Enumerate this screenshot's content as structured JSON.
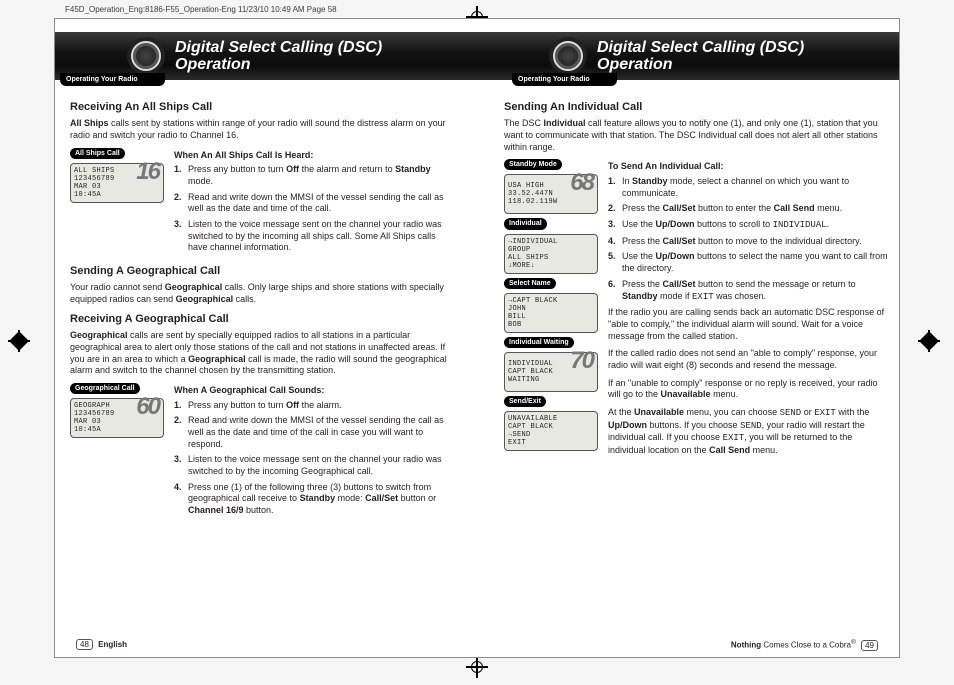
{
  "header_line": "F45D_Operation_Eng:8186-F55_Operation-Eng  11/23/10  10:49 AM  Page 58",
  "banner": {
    "left_title_1": "Digital Select Calling (DSC)",
    "left_title_2": "Operation",
    "right_title_1": "Digital Select Calling (DSC)",
    "right_title_2": "Operation",
    "left_sub": "Operating Your Radio",
    "right_sub": "Operating Your Radio"
  },
  "left": {
    "sec1_h": "Receiving An All Ships Call",
    "sec1_p": "All Ships calls sent by stations within range of your radio will sound the distress alarm on your radio and switch your radio to Channel 16.",
    "sec1_tag": "All Ships Call",
    "sec1_lcd_l1": "ALL SHIPS",
    "sec1_lcd_l2": "123456789",
    "sec1_lcd_l3": "MAR 03",
    "sec1_lcd_l4": "10:45A",
    "sec1_lcd_big": "16",
    "sec1_h3": "When An All Ships Call Is Heard:",
    "sec1_s1a": "Press any button to turn ",
    "sec1_s1b": "Off",
    "sec1_s1c": " the alarm and return to ",
    "sec1_s1d": "Standby",
    "sec1_s1e": " mode.",
    "sec1_s2": "Read and write down the MMSI of the vessel sending the call as well as the date and time of the call.",
    "sec1_s3": "Listen to the voice message sent on the channel your radio was switched to by the incoming all ships call. Some All Ships calls have channel information.",
    "sec2_h": "Sending A Geographical Call",
    "sec2_p1": "Your radio cannot send ",
    "sec2_p2": "Geographical",
    "sec2_p3": " calls. Only large ships and shore stations with specially equipped radios can send ",
    "sec2_p4": "Geographical",
    "sec2_p5": " calls.",
    "sec3_h": "Receiving A Geographical Call",
    "sec3_p1": "Geographical",
    "sec3_p2": " calls are sent by specially equipped radios to all stations in a particular geographical area to alert only those stations of the call and not stations in unaffected areas. If you are in an area to which a ",
    "sec3_p3": "Geographical",
    "sec3_p4": " call is made, the radio will sound the geographical alarm and switch to the channel chosen by the transmitting station.",
    "sec3_tag": "Geographical Call",
    "sec3_lcd_l1": "GEOGRAPH",
    "sec3_lcd_l2": "123456789",
    "sec3_lcd_l3": "MAR 03",
    "sec3_lcd_l4": "10:45A",
    "sec3_lcd_big": "60",
    "sec3_h3": "When A Geographical Call Sounds:",
    "sec3_s1a": "Press any button to turn ",
    "sec3_s1b": "Off",
    "sec3_s1c": " the alarm.",
    "sec3_s2": "Read and write down the MMSI of the vessel sending the call as well as the date and time of the call in case you will want to respond.",
    "sec3_s3": "Listen to the voice message sent on the channel your radio was switched to by the incoming Geographical call.",
    "sec3_s4a": "Press one (1) of the following three (3) buttons to switch from geographical call receive to ",
    "sec3_s4b": "Standby",
    "sec3_s4c": " mode: ",
    "sec3_s4d": "Call/Set",
    "sec3_s4e": " button or ",
    "sec3_s4f": "Channel 16/9",
    "sec3_s4g": " button."
  },
  "right": {
    "sec1_h": "Sending An Individual Call",
    "sec1_p1": "The DSC ",
    "sec1_p2": "Individual",
    "sec1_p3": " call feature allows you to notify one (1), and only one (1), station that you want to communicate with that station. The DSC Individual call does not alert all other stations within range.",
    "tag1": "Standby Mode",
    "lcd1_l1": "USA HIGH",
    "lcd1_l2": "33.52.447N",
    "lcd1_l3": "118.02.119W",
    "lcd1_big": "68",
    "tag2": "Individual",
    "lcd2_l1": "→INDIVIDUAL",
    "lcd2_l2": " GROUP",
    "lcd2_l3": " ALL SHIPS",
    "lcd2_l4": "↓MORE↓",
    "tag3": "Select Name",
    "lcd3_l1": "→CAPT BLACK",
    "lcd3_l2": " JOHN",
    "lcd3_l3": " BILL",
    "lcd3_l4": " BOB",
    "tag4": "Individual Waiting",
    "lcd4_l1": "INDIVIDUAL",
    "lcd4_l2": "CAPT BLACK",
    "lcd4_l3": "WAITING",
    "lcd4_big": "70",
    "tag5": "Send/Exit",
    "lcd5_l1": "UNAVAILABLE",
    "lcd5_l2": " CAPT BLACK",
    "lcd5_l3": "→SEND",
    "lcd5_l4": " EXIT",
    "h3": "To Send An Individual Call:",
    "s1a": "In ",
    "s1b": "Standby",
    "s1c": " mode, select a channel on which you want to communicate.",
    "s2a": "Press the ",
    "s2b": "Call/Set",
    "s2c": " button to enter the ",
    "s2d": "Call Send",
    "s2e": " menu.",
    "s3a": "Use the ",
    "s3b": "Up/Down",
    "s3c": " buttons to scroll to ",
    "s3d": "INDIVIDUAL",
    "s3e": ".",
    "s4a": "Press the ",
    "s4b": "Call/Set",
    "s4c": " button to move to the individual directory.",
    "s5a": "Use the ",
    "s5b": "Up/Down",
    "s5c": " buttons to select the name you want to call from the directory.",
    "s6a": "Press the ",
    "s6b": "Call/Set",
    "s6c": " button to send the message or return to ",
    "s6d": "Standby",
    "s6e": " mode if ",
    "s6f": "EXIT",
    "s6g": " was chosen.",
    "p2": "If the radio you are calling sends back an automatic DSC response of \"able to comply,\" the individual alarm will sound. Wait for a voice message from the called station.",
    "p3": "If the called radio does not send an \"able to comply\" response, your radio will wait eight (8) seconds and resend the message.",
    "p4a": "If an \"unable to comply\" response or no reply is received, your radio will go to the ",
    "p4b": "Unavailable",
    "p4c": " menu.",
    "p5a": "At the ",
    "p5b": "Unavailable",
    "p5c": " menu, you can choose ",
    "p5d": "SEND",
    "p5e": " or ",
    "p5f": "EXIT",
    "p5g": " with the ",
    "p5h": "Up/Down",
    "p5i": " buttons. If you choose ",
    "p5j": "SEND",
    "p5k": ", your radio will restart the individual call. If you choose ",
    "p5l": "EXIT",
    "p5m": ", you will be returned to the individual location on the ",
    "p5n": "Call Send",
    "p5o": " menu."
  },
  "footer": {
    "left_num": "48",
    "left_text": "English",
    "right_text_1": "Nothing",
    "right_text_2": " Comes Close to a Cobra",
    "right_sup": "®",
    "right_num": "49"
  }
}
